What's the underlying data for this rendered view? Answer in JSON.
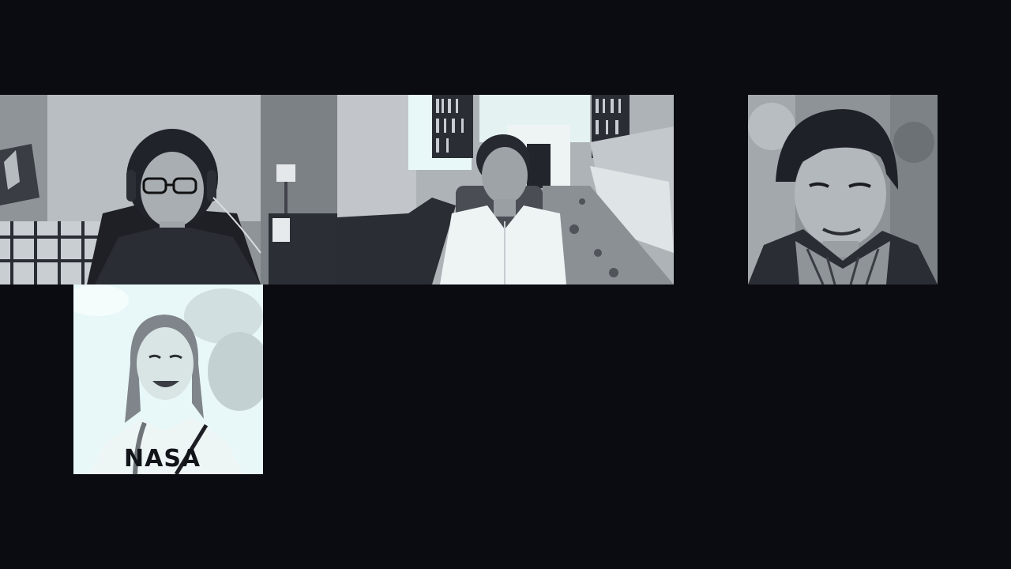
{
  "participants": [
    {
      "id": "participant-1",
      "shirt_text": ""
    },
    {
      "id": "participant-2",
      "shirt_text": ""
    },
    {
      "id": "participant-3",
      "shirt_text": ""
    },
    {
      "id": "participant-4",
      "shirt_text": "NASA"
    }
  ],
  "colors": {
    "background": "#0b0c12",
    "video_tint_light": "#e8f8f8",
    "video_tint_mid": "#9ea3a8",
    "video_tint_dark": "#1a1c22"
  }
}
